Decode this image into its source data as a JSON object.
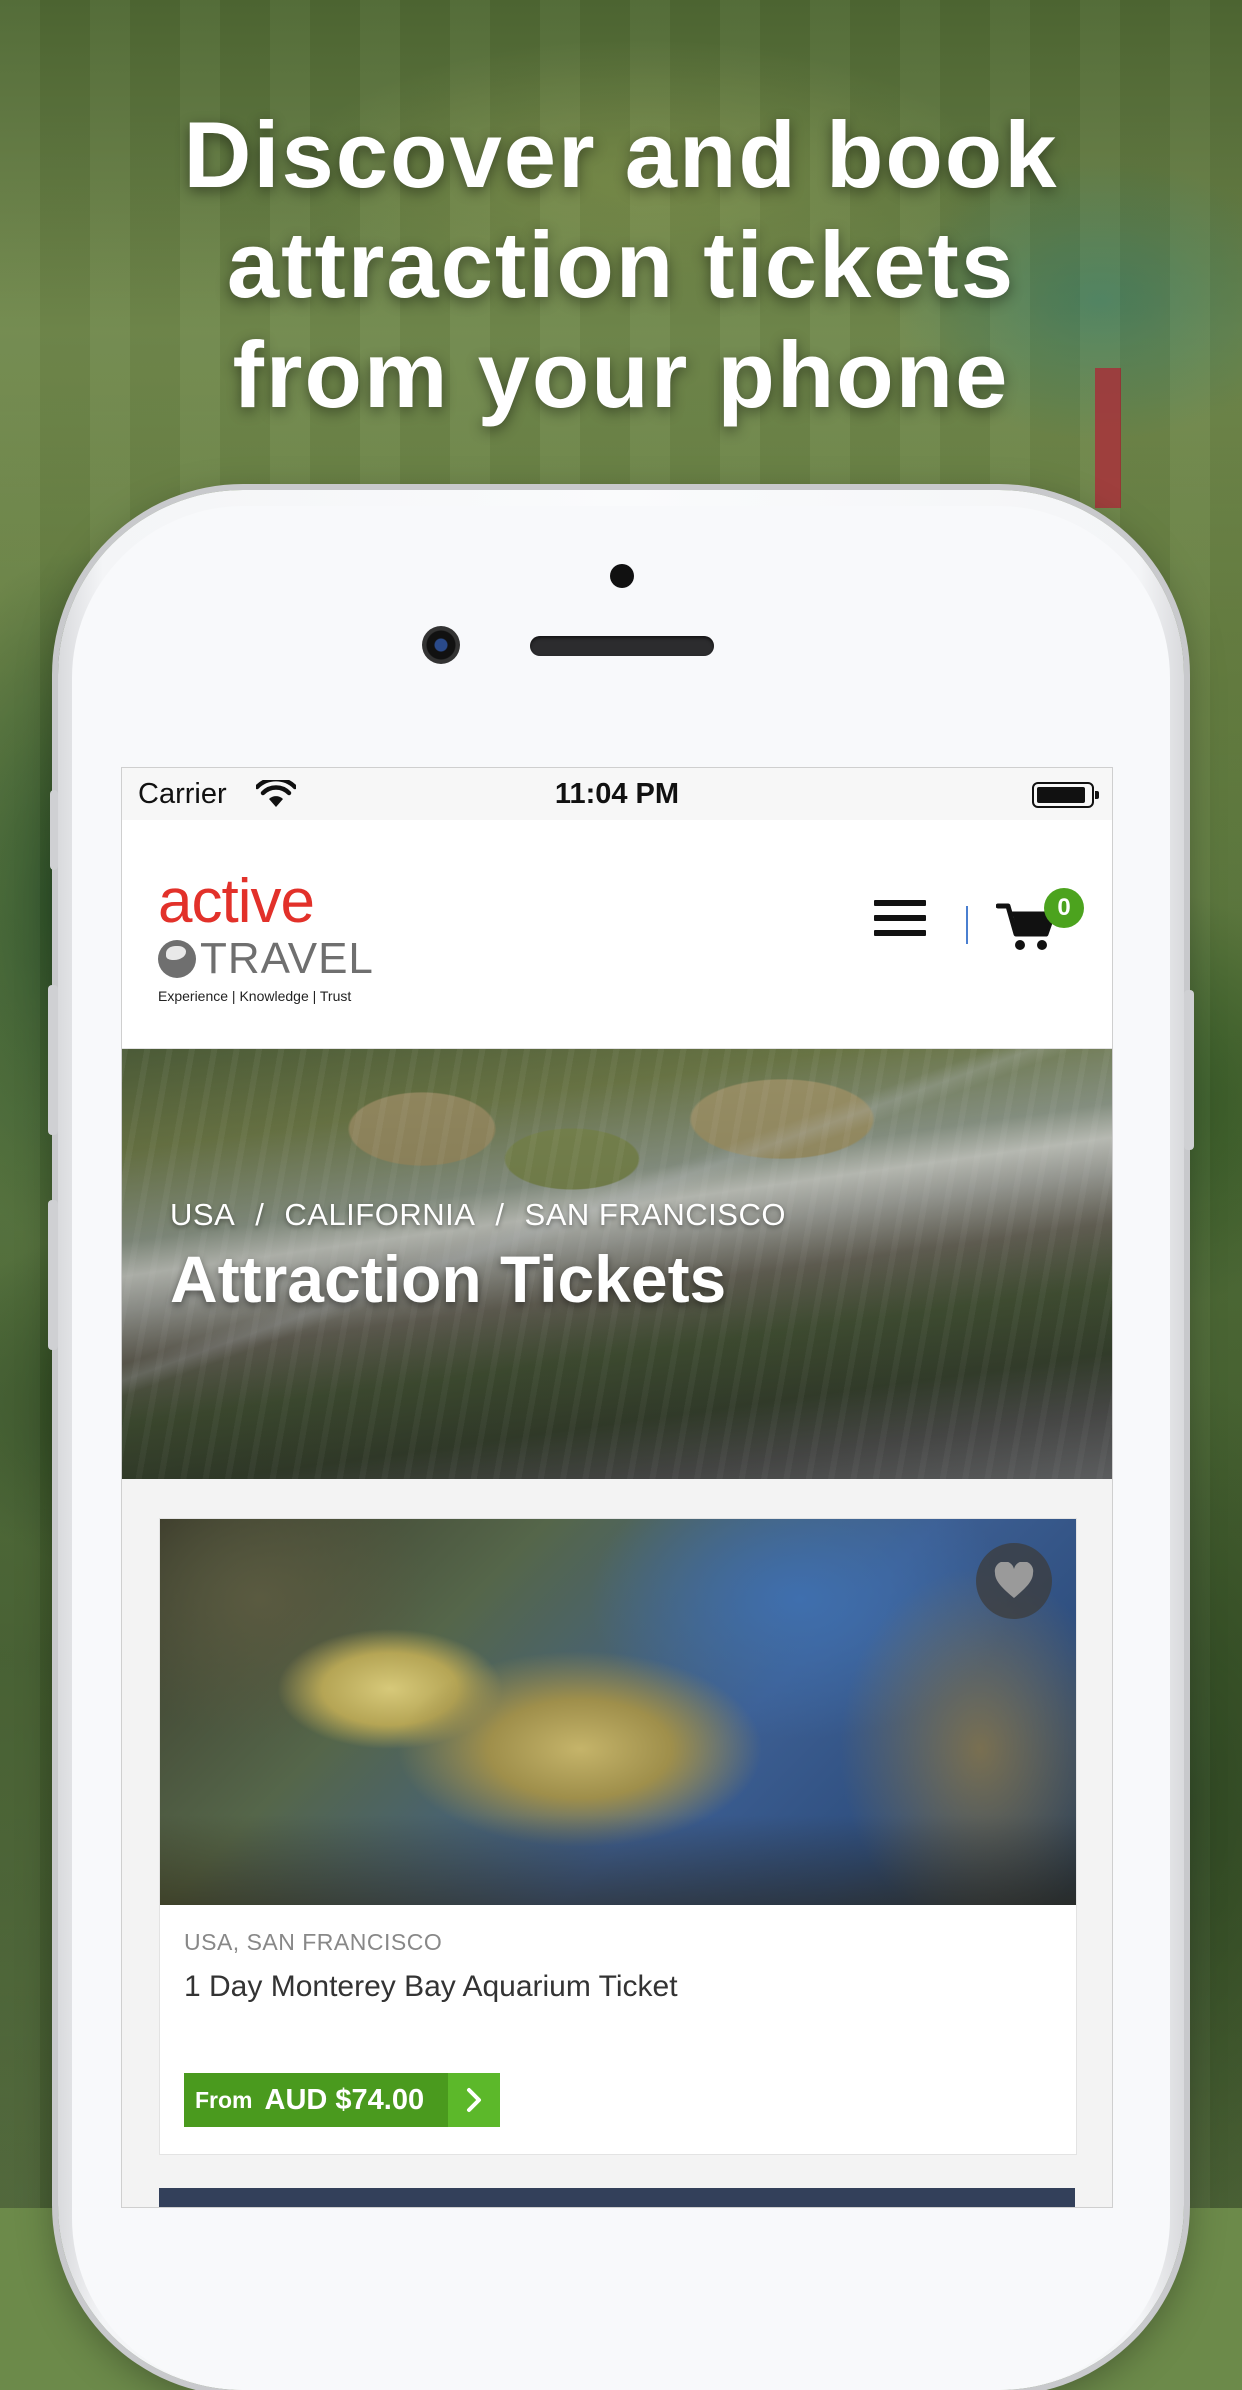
{
  "promo": {
    "headline_lines": [
      "Discover and book",
      "attraction tickets",
      "from your phone"
    ]
  },
  "status_bar": {
    "carrier": "Carrier",
    "time": "11:04 PM"
  },
  "header": {
    "logo_word": "active",
    "logo_sub": "TRAVEL",
    "logo_tagline": "Experience | Knowledge | Trust",
    "cart_count": "0"
  },
  "hero": {
    "breadcrumb": [
      "USA",
      "CALIFORNIA",
      "SAN FRANCISCO"
    ],
    "breadcrumb_sep": "/",
    "title": "Attraction Tickets"
  },
  "listing": {
    "cards": [
      {
        "location": "USA, SAN FRANCISCO",
        "title": "1 Day Monterey Bay Aquarium Ticket",
        "price_prefix": "From",
        "price": "AUD $74.00"
      }
    ]
  },
  "colors": {
    "brand_red": "#e2312a",
    "price_green": "#4a9a1e",
    "badge_green": "#4ca31e"
  }
}
